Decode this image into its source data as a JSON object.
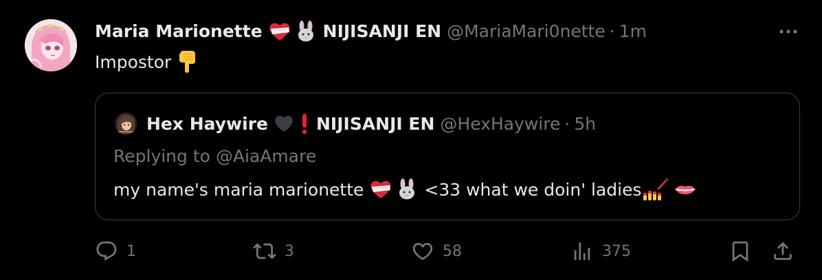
{
  "tweet": {
    "author": {
      "name": "Maria Marionette",
      "affiliation": "NIJISANJI EN",
      "handle": "@MariaMari0nette",
      "time": "1m",
      "separator": "·"
    },
    "text": "Impostor",
    "text_emoji": "pointing-down-hand",
    "quote": {
      "author": {
        "name": "Hex Haywire",
        "affiliation": "NIJISANJI EN",
        "handle": "@HexHaywire",
        "time": "5h",
        "separator": "·"
      },
      "replying_prefix": "Replying to",
      "replying_handle": "@AiaAmare",
      "text_part1": "my name's maria marionette",
      "text_part2": "<33 what we doin' ladies"
    },
    "actions": {
      "reply_count": "1",
      "retweet_count": "3",
      "like_count": "58",
      "views_count": "375"
    }
  },
  "icons": {
    "more": "more-horizontal-icon",
    "reply": "reply-icon",
    "retweet": "retweet-icon",
    "like": "heart-icon",
    "views": "views-bar-chart-icon",
    "bookmark": "bookmark-icon",
    "share": "share-icon"
  },
  "colors": {
    "background": "#000000",
    "text_primary": "#e7e9ea",
    "text_secondary": "#71767b",
    "border": "#3c4045",
    "heart_red": "#e0245e"
  }
}
